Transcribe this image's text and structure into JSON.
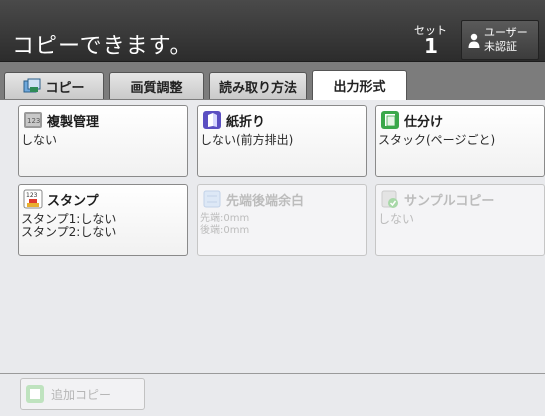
{
  "header": {
    "status": "コピーできます。",
    "set_label": "セット",
    "set_count": "1",
    "user_line1": "ユーザー",
    "user_line2": "未認証"
  },
  "tabs": [
    {
      "label": "コピー",
      "icon": "copy-icon",
      "active": false
    },
    {
      "label": "画質調整",
      "active": false
    },
    {
      "label": "読み取り方法",
      "active": false
    },
    {
      "label": "出力形式",
      "active": true
    }
  ],
  "functions": [
    {
      "title": "複製管理",
      "value": "しない",
      "icon": "duplicate-control-icon",
      "enabled": true
    },
    {
      "title": "紙折り",
      "value": "しない(前方排出)",
      "icon": "paper-fold-icon",
      "enabled": true
    },
    {
      "title": "仕分け",
      "value": "スタック(ページごと)",
      "icon": "sort-icon",
      "enabled": true
    },
    {
      "title": "スタンプ",
      "value": "スタンプ1:しない\nスタンプ2:しない",
      "icon": "stamp-icon",
      "enabled": true
    },
    {
      "title": "先端後端余白",
      "value": "先端:0mm\n後端:0mm",
      "icon": "margin-icon",
      "enabled": false
    },
    {
      "title": "サンプルコピー",
      "value": "しない",
      "icon": "sample-copy-icon",
      "enabled": false
    }
  ],
  "footer": {
    "extra_copy_label": "追加コピー"
  },
  "colors": {
    "header": "#3a3a3a",
    "tab_bar": "#7c7c7c",
    "panel": "#e9eaed"
  }
}
